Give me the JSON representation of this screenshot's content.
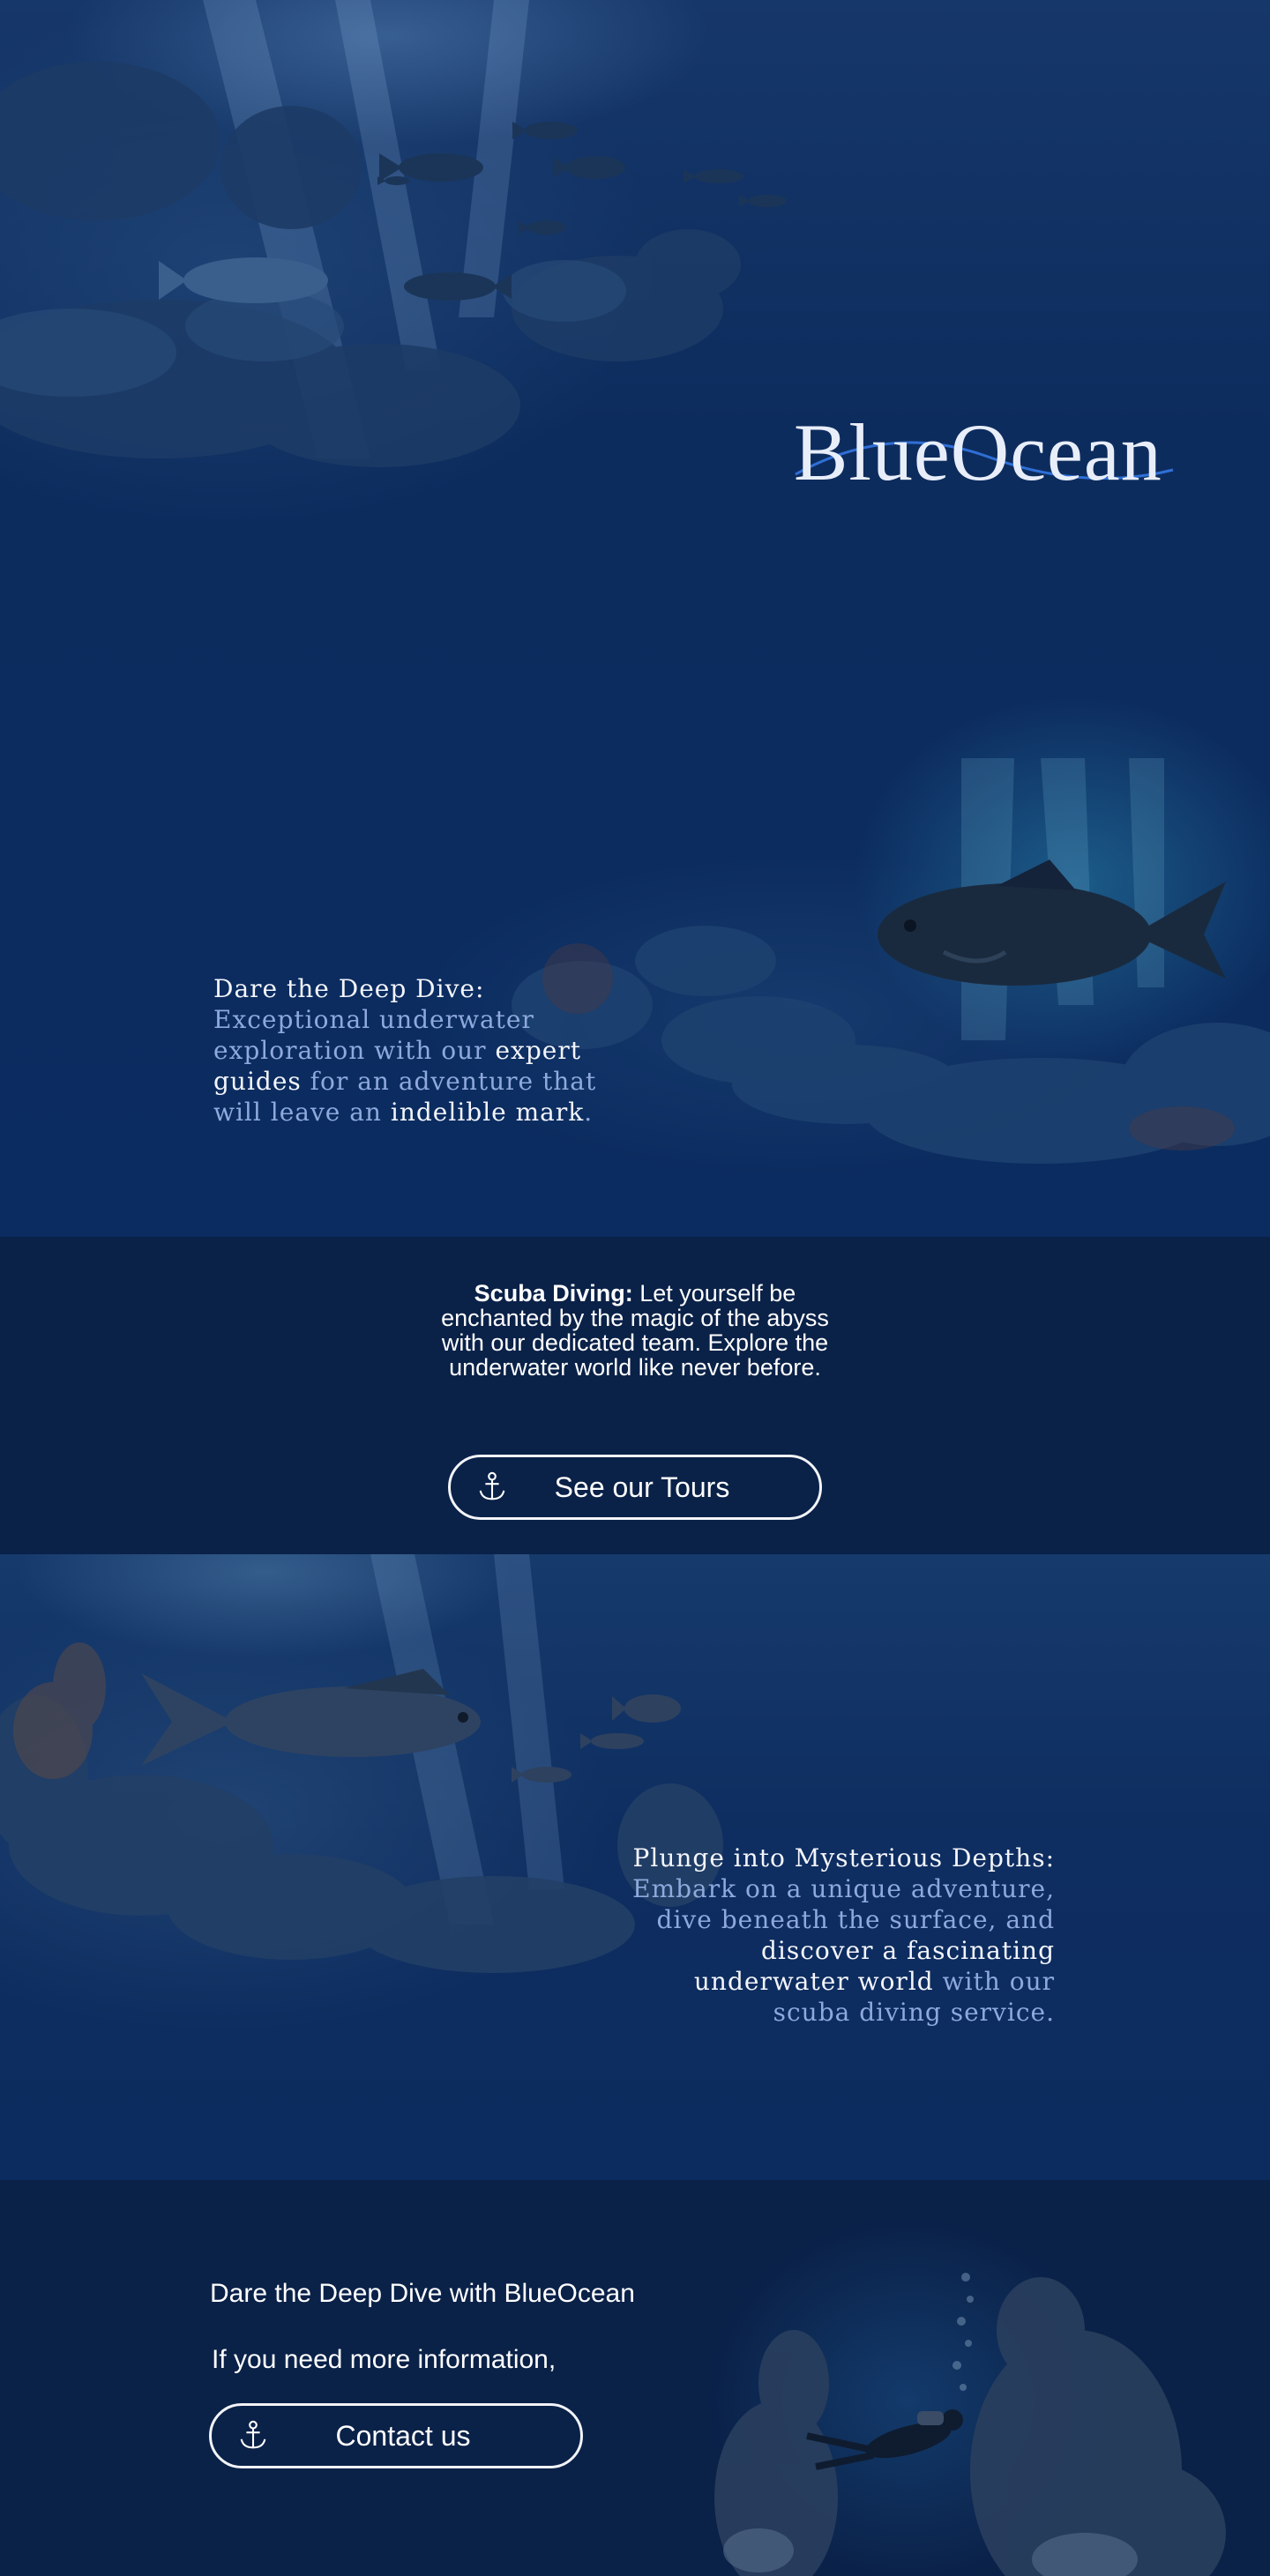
{
  "brand": {
    "logo_text": "BlueOcean",
    "accent_color": "#2f6fd6"
  },
  "hero": {
    "lead": "Dare the Deep Dive:",
    "p1": " Exceptional underwater exploration with our ",
    "h1": "expert guides",
    "p2": " for an adventure that will leave an ",
    "h2": "indelible mark",
    "p3": "."
  },
  "scuba": {
    "strong": "Scuba Diving:",
    "text": " Let yourself be enchanted by the magic of the abyss with our dedicated team. Explore the underwater world like never before.",
    "button_label": "See our Tours",
    "button_icon": "anchor-icon"
  },
  "plunge": {
    "lead": "Plunge into Mysterious Depths:",
    "p1": " Embark on a unique adventure, dive beneath the surface, and ",
    "h1": "discover a fascinating underwater world",
    "p2": " with our scuba diving service."
  },
  "contact": {
    "title": "Dare the Deep Dive with BlueOcean",
    "subtitle": "If you need more information,",
    "button_label": "Contact us",
    "button_icon": "anchor-icon"
  },
  "colors": {
    "page_bg": "#0c2a5a",
    "band_bg": "#0a2148",
    "highlight_text": "#f3f5fb",
    "muted_text": "#8ea9dc"
  }
}
